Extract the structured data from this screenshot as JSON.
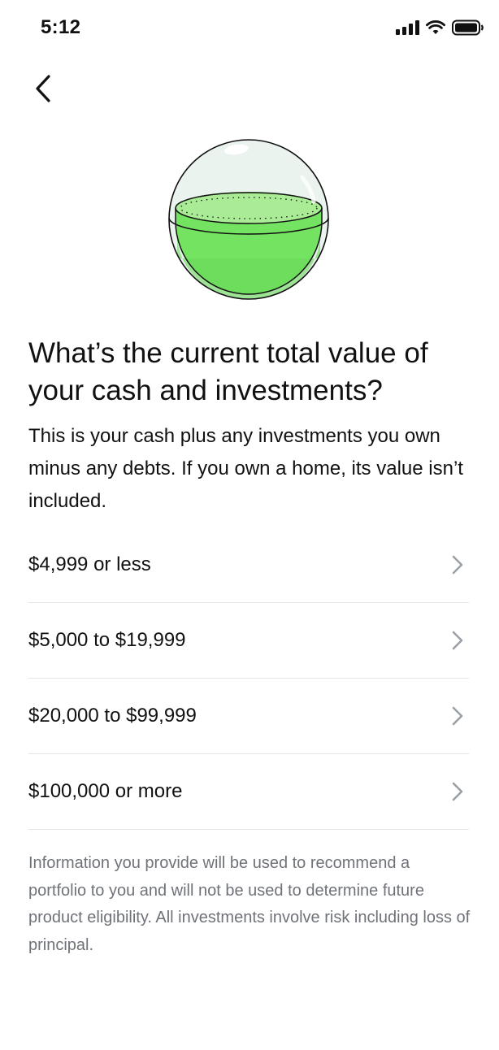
{
  "status_bar": {
    "time": "5:12",
    "icons": [
      "cellular-signal-icon",
      "wifi-icon",
      "battery-icon"
    ]
  },
  "nav": {
    "back_icon": "chevron-left-icon"
  },
  "illustration": {
    "icon": "glass-sphere-with-green-liquid",
    "colors": {
      "liquid": "#6fe05c",
      "liquid_top": "#a8ec93",
      "glass": "#e4efe9"
    }
  },
  "question": {
    "title": "What’s the current total value of your cash and investments?",
    "description": "This is your cash plus any investments you own minus any debts. If you own a home, its value isn’t included."
  },
  "options": [
    {
      "label": "$4,999 or less"
    },
    {
      "label": "$5,000 to $19,999"
    },
    {
      "label": "$20,000 to $99,999"
    },
    {
      "label": "$100,000 or more"
    }
  ],
  "disclaimer": "Information you provide will be used to recommend a portfolio to you and will not be used to determine future product eligibility. All investments involve risk including loss of principal.",
  "colors": {
    "text": "#111111",
    "muted": "#6f7379",
    "divider": "#e3e5e8",
    "chevron": "#9aa0a6"
  }
}
